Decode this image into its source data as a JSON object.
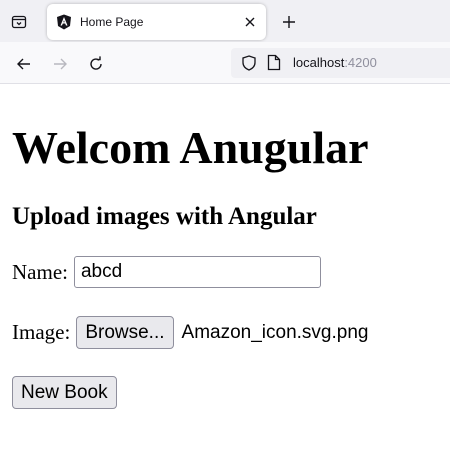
{
  "browser": {
    "tab": {
      "title": "Home Page"
    },
    "url": {
      "host": "localhost",
      "port": ":4200"
    }
  },
  "page": {
    "heading": "Welcom Anugular",
    "subheading": "Upload images with Angular",
    "form": {
      "name_label": "Name:",
      "name_value": "abcd",
      "image_label": "Image:",
      "browse_label": "Browse...",
      "file_name": "Amazon_icon.svg.png",
      "submit_label": "New Book"
    }
  },
  "colors": {
    "angular_red": "#dd0031",
    "chrome_bg": "#f0f0f4",
    "icon": "#15141a"
  },
  "icons": {
    "tab_list": "tab-list-icon",
    "favicon": "angular-logo-icon",
    "close": "close-icon",
    "new_tab": "plus-icon",
    "back": "back-arrow-icon",
    "forward": "forward-arrow-icon",
    "reload": "reload-icon",
    "shield": "shield-icon",
    "page": "page-icon"
  }
}
